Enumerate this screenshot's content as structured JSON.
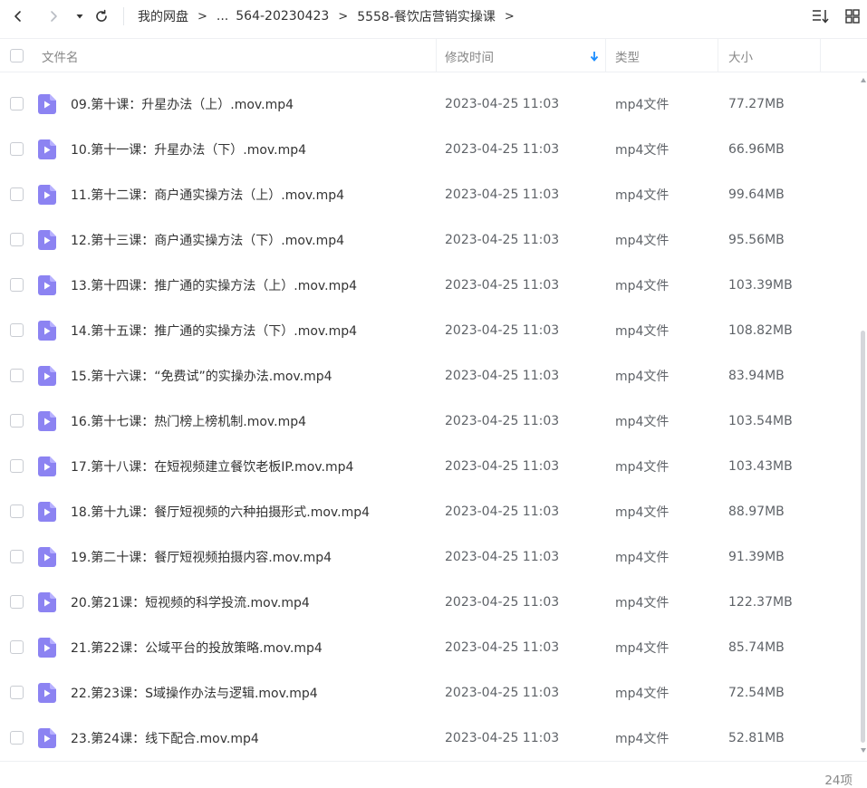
{
  "breadcrumb": {
    "items": [
      "我的网盘",
      "...",
      "564-20230423",
      "5558-餐饮店营销实操课"
    ],
    "separator": ">"
  },
  "columns": {
    "name": "文件名",
    "modified": "修改时间",
    "type": "类型",
    "size": "大小"
  },
  "colors": {
    "accent": "#1a8cff",
    "file_icon": "#8c83f2"
  },
  "icons": {
    "back": "chevron-left-icon",
    "forward": "chevron-right-icon",
    "history": "caret-down-icon",
    "refresh": "refresh-icon",
    "sort": "sort-list-icon",
    "view": "grid-view-icon",
    "file": "video-file-icon",
    "sort_direction": "arrow-down-icon"
  },
  "files": [
    {
      "name": "09.第十课：升星办法（上）.mov.mp4",
      "modified": "2023-04-25 11:03",
      "type": "mp4文件",
      "size": "77.27MB"
    },
    {
      "name": "10.第十一课：升星办法（下）.mov.mp4",
      "modified": "2023-04-25 11:03",
      "type": "mp4文件",
      "size": "66.96MB"
    },
    {
      "name": "11.第十二课：商户通实操方法（上）.mov.mp4",
      "modified": "2023-04-25 11:03",
      "type": "mp4文件",
      "size": "99.64MB"
    },
    {
      "name": "12.第十三课：商户通实操方法（下）.mov.mp4",
      "modified": "2023-04-25 11:03",
      "type": "mp4文件",
      "size": "95.56MB"
    },
    {
      "name": "13.第十四课：推广通的实操方法（上）.mov.mp4",
      "modified": "2023-04-25 11:03",
      "type": "mp4文件",
      "size": "103.39MB"
    },
    {
      "name": "14.第十五课：推广通的实操方法（下）.mov.mp4",
      "modified": "2023-04-25 11:03",
      "type": "mp4文件",
      "size": "108.82MB"
    },
    {
      "name": "15.第十六课：“免费试”的实操办法.mov.mp4",
      "modified": "2023-04-25 11:03",
      "type": "mp4文件",
      "size": "83.94MB"
    },
    {
      "name": "16.第十七课：热门榜上榜机制.mov.mp4",
      "modified": "2023-04-25 11:03",
      "type": "mp4文件",
      "size": "103.54MB"
    },
    {
      "name": "17.第十八课：在短视频建立餐饮老板IP.mov.mp4",
      "modified": "2023-04-25 11:03",
      "type": "mp4文件",
      "size": "103.43MB"
    },
    {
      "name": "18.第十九课：餐厅短视频的六种拍摄形式.mov.mp4",
      "modified": "2023-04-25 11:03",
      "type": "mp4文件",
      "size": "88.97MB"
    },
    {
      "name": "19.第二十课：餐厅短视频拍摄内容.mov.mp4",
      "modified": "2023-04-25 11:03",
      "type": "mp4文件",
      "size": "91.39MB"
    },
    {
      "name": "20.第21课：短视频的科学投流.mov.mp4",
      "modified": "2023-04-25 11:03",
      "type": "mp4文件",
      "size": "122.37MB"
    },
    {
      "name": "21.第22课：公域平台的投放策略.mov.mp4",
      "modified": "2023-04-25 11:03",
      "type": "mp4文件",
      "size": "85.74MB"
    },
    {
      "name": "22.第23课：S域操作办法与逻辑.mov.mp4",
      "modified": "2023-04-25 11:03",
      "type": "mp4文件",
      "size": "72.54MB"
    },
    {
      "name": "23.第24课：线下配合.mov.mp4",
      "modified": "2023-04-25 11:03",
      "type": "mp4文件",
      "size": "52.81MB"
    }
  ],
  "footer": {
    "count": "24项"
  }
}
